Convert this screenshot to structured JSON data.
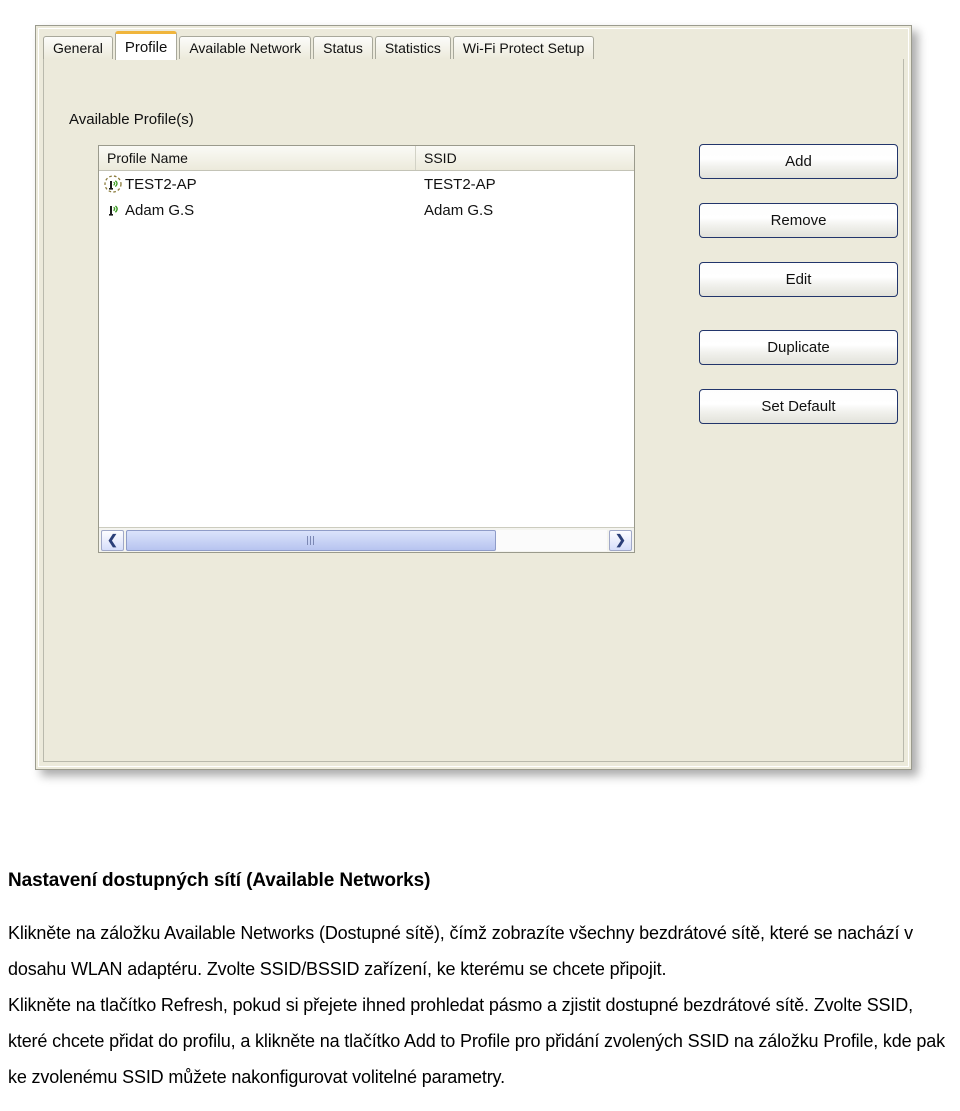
{
  "window": {
    "tabs": [
      {
        "label": "General",
        "selected": false
      },
      {
        "label": "Profile",
        "selected": true
      },
      {
        "label": "Available Network",
        "selected": false
      },
      {
        "label": "Status",
        "selected": false
      },
      {
        "label": "Statistics",
        "selected": false
      },
      {
        "label": "Wi-Fi Protect Setup",
        "selected": false
      }
    ],
    "group_label": "Available Profile(s)",
    "list": {
      "columns": [
        "Profile Name",
        "SSID"
      ],
      "rows": [
        {
          "name": "TEST2-AP",
          "ssid": "TEST2-AP",
          "icon": "wireless-antenna-default-icon",
          "is_default": true
        },
        {
          "name": "Adam G.S",
          "ssid": "Adam G.S",
          "icon": "wireless-antenna-icon",
          "is_default": false
        }
      ]
    },
    "scrollbar": {
      "left_arrow": "❮",
      "right_arrow": "❯"
    },
    "buttons": [
      {
        "label": "Add"
      },
      {
        "label": "Remove"
      },
      {
        "label": "Edit"
      },
      {
        "label": "Duplicate"
      },
      {
        "label": "Set Default"
      }
    ]
  },
  "document": {
    "heading": "Nastavení dostupných sítí (Available Networks)",
    "paragraph1": "Klikněte na záložku Available Networks (Dostupné sítě), čímž zobrazíte všechny bezdrátové sítě, které se nachází v dosahu WLAN adaptéru. Zvolte SSID/BSSID zařízení, ke kterému se chcete připojit.",
    "paragraph2": "Klikněte na tlačítko Refresh, pokud si přejete ihned prohledat pásmo a zjistit dostupné bezdrátové sítě. Zvolte SSID, které chcete přidat do profilu, a klikněte na tlačítko Add to Profile pro přidání zvolených SSID na záložku Profile, kde pak ke zvolenému SSID můžete nakonfigurovat volitelné parametry."
  },
  "colors": {
    "panel": "#ECEADB",
    "selected_tab_accent": "#F0B53C",
    "listview_background": "#FFFFFF",
    "button_border": "#22356B",
    "scrollbar_thumb": "#B7C4F0",
    "icon_green": "#3C9A22"
  }
}
